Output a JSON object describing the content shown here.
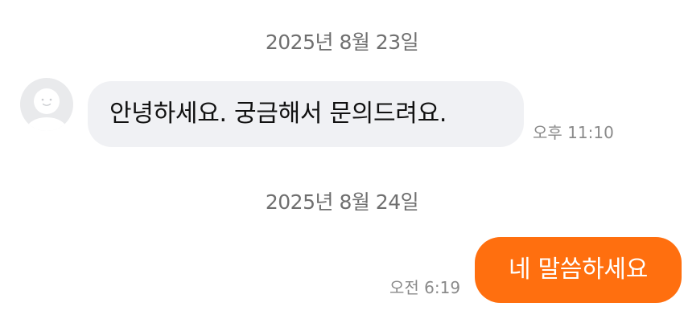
{
  "chat": {
    "date_separators": [
      "2025년 8월 23일",
      "2025년 8월 24일"
    ],
    "messages": [
      {
        "direction": "incoming",
        "text": "안녕하세요. 궁금해서 문의드려요.",
        "time": "오후 11:10"
      },
      {
        "direction": "outgoing",
        "text": "네 말씀하세요",
        "time": "오전 6:19"
      }
    ]
  },
  "colors": {
    "outgoing_bubble": "#ff6f0f",
    "incoming_bubble": "#f0f1f4",
    "avatar_bg": "#e9eaec"
  },
  "icons": {
    "avatar": "default-profile-icon"
  }
}
